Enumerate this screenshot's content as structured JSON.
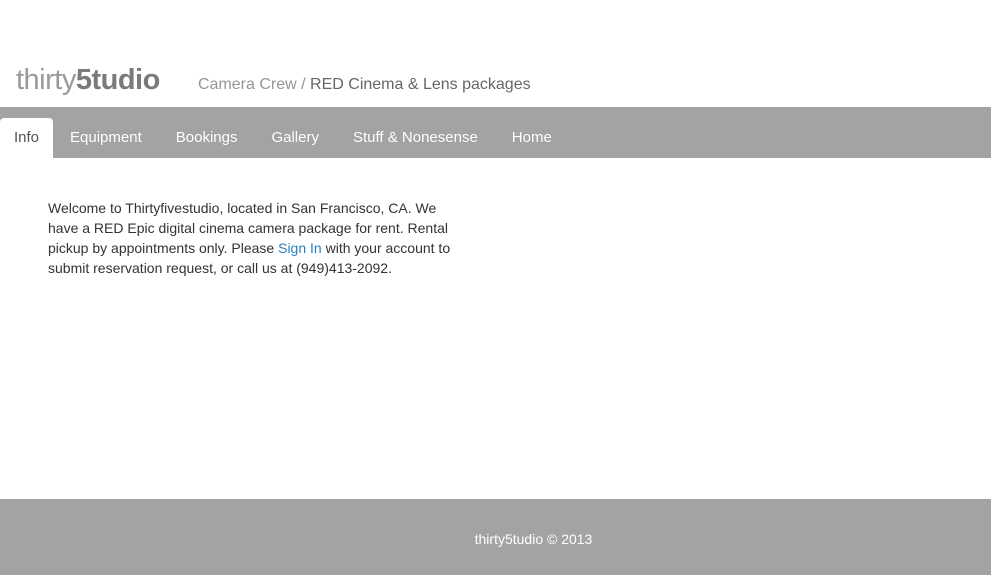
{
  "brand": {
    "name_light": "thirty",
    "name_bold": "5tudio"
  },
  "tagline": {
    "part1": "Camera Crew / ",
    "part2": "RED Cinema & Lens packages"
  },
  "nav": {
    "items": [
      {
        "label": "Info",
        "active": true
      },
      {
        "label": "Equipment",
        "active": false
      },
      {
        "label": "Bookings",
        "active": false
      },
      {
        "label": "Gallery",
        "active": false
      },
      {
        "label": "Stuff & Nonesense",
        "active": false
      },
      {
        "label": "Home",
        "active": false
      }
    ]
  },
  "main": {
    "text_before_link": "Welcome to Thirtyfivestudio, located in San Francisco, CA. We have a RED Epic digital cinema camera package for rent. Rental pickup by appointments only. Please ",
    "link_label": "Sign In",
    "text_after_link": " with your account to submit reservation request, or call us at (949)413-2092."
  },
  "footer": {
    "text": "thirty5tudio © 2013"
  },
  "colors": {
    "nav_background": "#a3a3a3",
    "link": "#2a7fbf",
    "body_text": "#333333"
  }
}
